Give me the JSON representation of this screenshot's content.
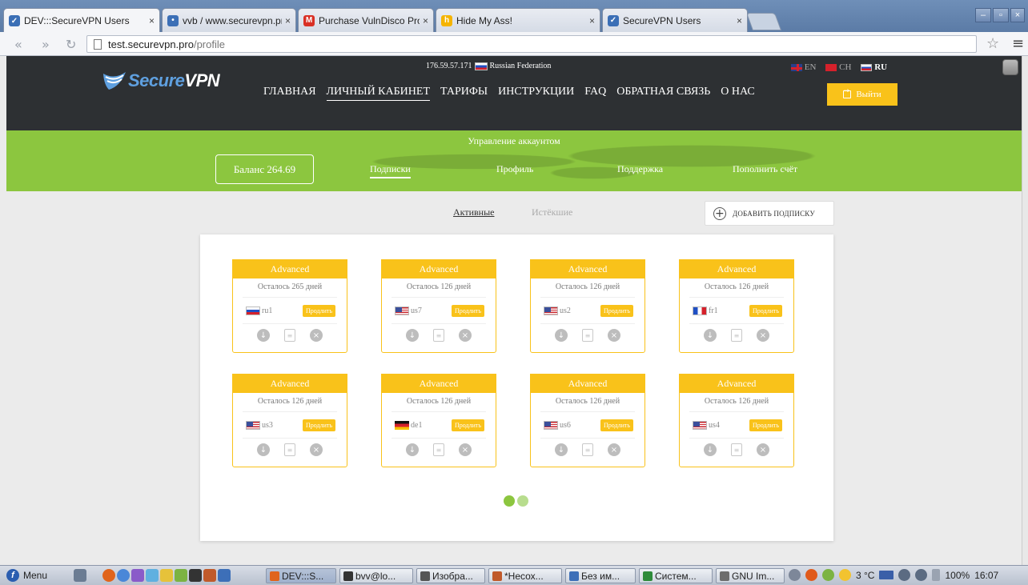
{
  "browser": {
    "tabs": [
      {
        "title": "DEV:::SecureVPN Users",
        "close": "×",
        "favicon_color": "#3b6fb6",
        "active": true
      },
      {
        "title": "vvb / www.securevpn.pro",
        "close": "×",
        "favicon_color": "#3b6fb6"
      },
      {
        "title": "Purchase VulnDisco Pro ai",
        "close": "×",
        "favicon_color": "#d93025"
      },
      {
        "title": "Hide My Ass!",
        "close": "×",
        "favicon_color": "#f5b400"
      },
      {
        "title": "SecureVPN Users",
        "close": "×",
        "favicon_color": "#3b6fb6"
      }
    ],
    "url_host": "test.securevpn.pro",
    "url_path": "/profile",
    "window_buttons": [
      "–",
      "▫",
      "×"
    ]
  },
  "header": {
    "ip": "176.59.57.171",
    "country": "Russian Federation",
    "languages": [
      {
        "code": "EN",
        "flag": "gb"
      },
      {
        "code": "CH",
        "flag": "cn"
      },
      {
        "code": "RU",
        "flag": "ru",
        "active": true
      }
    ],
    "logo_secure": "Secure",
    "logo_vpn": "VPN",
    "nav": [
      "ГЛАВНАЯ",
      "ЛИЧНЫЙ КАБИНЕТ",
      "ТАРИФЫ",
      "ИНСТРУКЦИИ",
      "FAQ",
      "ОБРАТНАЯ СВЯЗЬ",
      "О НАС"
    ],
    "nav_active_index": 1,
    "logout": "Выйти"
  },
  "account": {
    "title": "Управление аккаунтом",
    "balance": "Баланс 264.69",
    "subnav": [
      "Подписки",
      "Профиль",
      "Поддержка",
      "Пополнить счёт"
    ]
  },
  "filters": {
    "active": "Активные",
    "expired": "Истёкшие",
    "add_subscription": "ДОБАВИТЬ ПОДПИСКУ"
  },
  "subscriptions": [
    {
      "plan": "Advanced",
      "days": "Осталось 265 дней",
      "server": "ru1",
      "flag": "ru",
      "renew": "Продлить"
    },
    {
      "plan": "Advanced",
      "days": "Осталось 126 дней",
      "server": "us7",
      "flag": "us",
      "renew": "Продлить"
    },
    {
      "plan": "Advanced",
      "days": "Осталось 126 дней",
      "server": "us2",
      "flag": "us",
      "renew": "Продлить"
    },
    {
      "plan": "Advanced",
      "days": "Осталось 126 дней",
      "server": "fr1",
      "flag": "fr",
      "renew": "Продлить"
    },
    {
      "plan": "Advanced",
      "days": "Осталось 126 дней",
      "server": "us3",
      "flag": "us",
      "renew": "Продлить"
    },
    {
      "plan": "Advanced",
      "days": "Осталось 126 дней",
      "server": "de1",
      "flag": "de",
      "renew": "Продлить"
    },
    {
      "plan": "Advanced",
      "days": "Осталось 126 дней",
      "server": "us6",
      "flag": "us",
      "renew": "Продлить"
    },
    {
      "plan": "Advanced",
      "days": "Осталось 126 дней",
      "server": "us4",
      "flag": "us",
      "renew": "Продлить"
    }
  ],
  "card_action_icons": [
    "download-icon",
    "edit-icon",
    "delete-icon"
  ],
  "pagination": {
    "pages": 2,
    "current": 1
  },
  "taskbar": {
    "menu": "Menu",
    "tasks": [
      "DEV:::S...",
      "bvv@lo...",
      "Изобра...",
      "*Несох...",
      "Без им...",
      "Систем...",
      "GNU Im..."
    ],
    "temperature": "3 °C",
    "battery": "100%",
    "time": "16:07"
  },
  "colors": {
    "accent_yellow": "#f9c21a",
    "accent_green": "#8cc63f",
    "header_dark": "#2d3033",
    "logo_blue": "#5fa0e0"
  }
}
